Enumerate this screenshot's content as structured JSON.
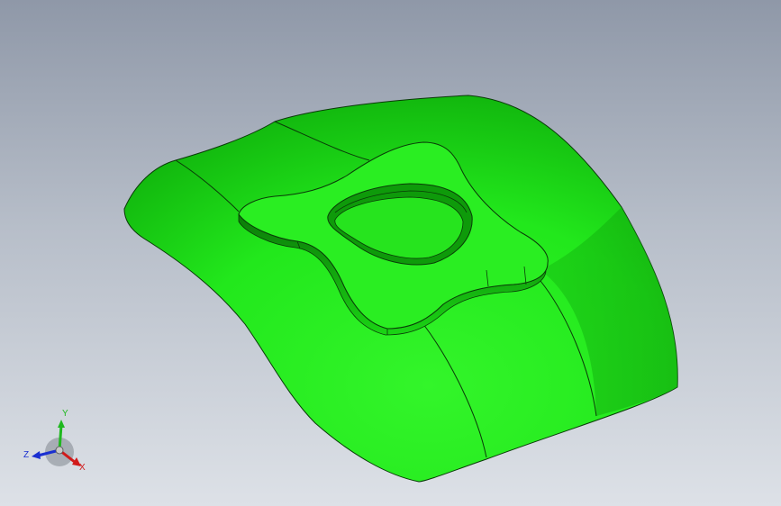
{
  "viewport": {
    "background_top": "#8f98a8",
    "background_bottom": "#dde1e7"
  },
  "model": {
    "face_color": "#22e81c",
    "edge_color": "#0a3a08"
  },
  "triad": {
    "x_label": "X",
    "y_label": "Y",
    "z_label": "Z",
    "x_color": "#d11a1a",
    "y_color": "#1fb81f",
    "z_color": "#1a2fd1"
  }
}
